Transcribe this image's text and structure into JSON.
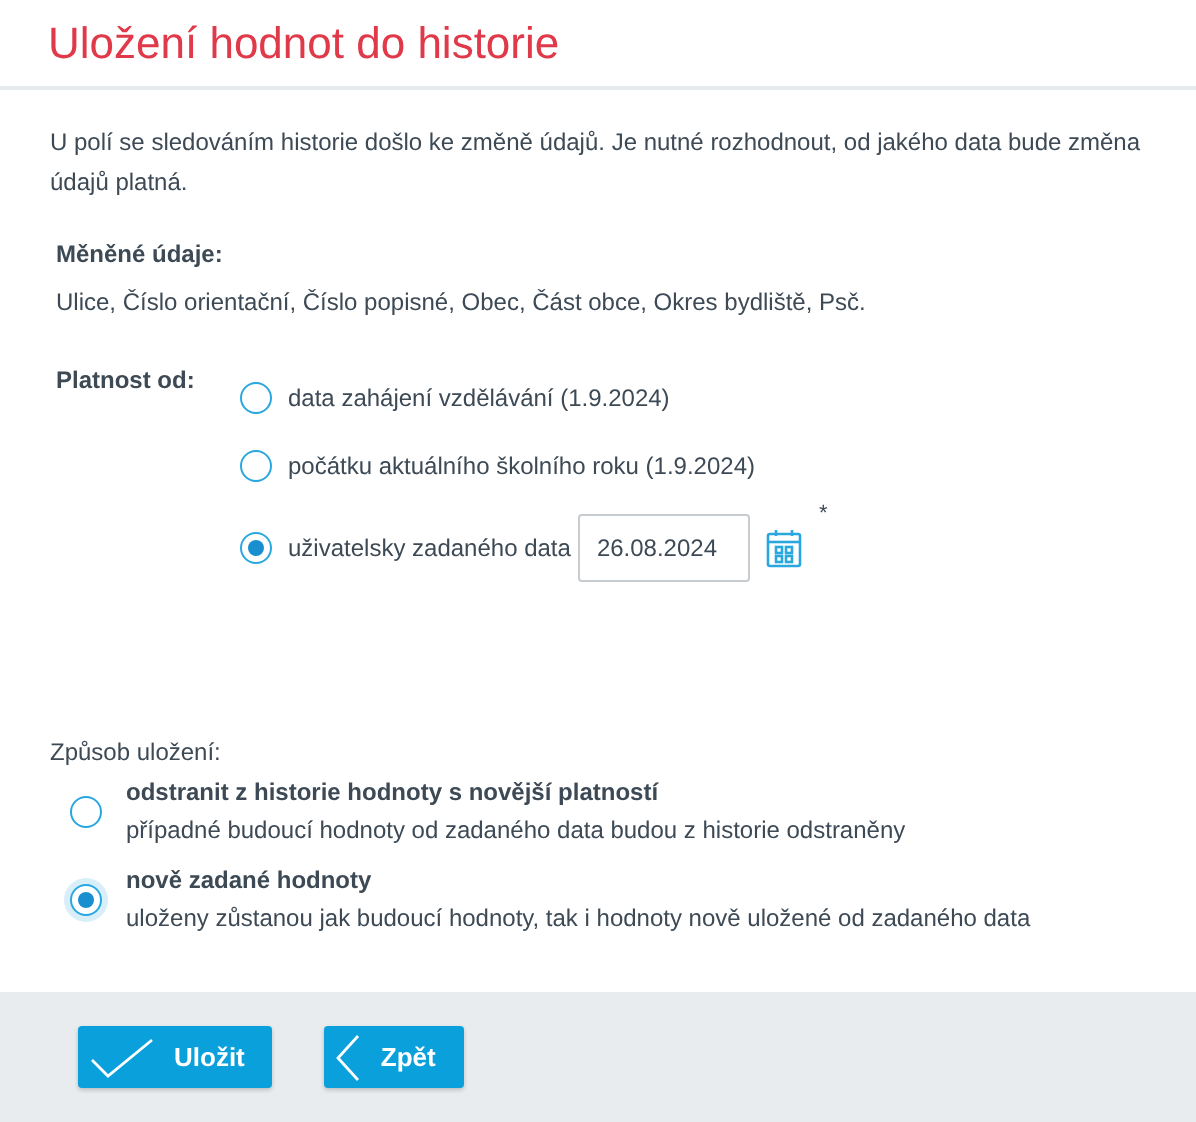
{
  "title": "Uložení hodnot do historie",
  "intro": "U polí se sledováním historie došlo ke změně údajů. Je nutné rozhodnout, od jakého data bude změna údajů platná.",
  "changed": {
    "label": "Měněné údaje:",
    "value": "Ulice, Číslo orientační, Číslo popisné, Obec, Část obce, Okres bydliště, Psč."
  },
  "validity": {
    "label": "Platnost od:",
    "options": [
      {
        "kind": "plain",
        "label": "data zahájení vzdělávání (1.9.2024)",
        "selected": false
      },
      {
        "kind": "plain",
        "label": "počátku aktuálního školního roku (1.9.2024)",
        "selected": false
      },
      {
        "kind": "date",
        "label": "uživatelsky zadaného data",
        "value": "26.08.2024",
        "required_mark": "*",
        "selected": true
      }
    ]
  },
  "save_mode": {
    "label": "Způsob uložení:",
    "options": [
      {
        "title": "odstranit z historie hodnoty s novější platností",
        "description": "případné budoucí hodnoty od zadaného data budou z historie odstraněny",
        "selected": false
      },
      {
        "title": "nově zadané hodnoty",
        "description": "uloženy zůstanou jak budoucí hodnoty, tak i hodnoty nově uložené od zadaného data",
        "selected": true
      }
    ]
  },
  "buttons": [
    {
      "kind": "save",
      "label": "Uložit"
    },
    {
      "kind": "back",
      "label": "Zpět"
    }
  ]
}
